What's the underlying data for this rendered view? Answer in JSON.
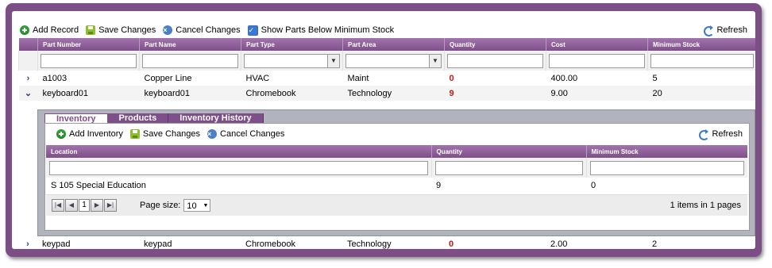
{
  "toolbar": {
    "add_record": "Add Record",
    "save_changes": "Save Changes",
    "cancel_changes": "Cancel Changes",
    "show_parts_below_min": "Show Parts Below Minimum Stock",
    "show_parts_checked": true,
    "refresh": "Refresh"
  },
  "grid": {
    "columns": [
      "Part Number",
      "Part Name",
      "Part Type",
      "Part Area",
      "Quantity",
      "Cost",
      "Minimum Stock"
    ],
    "rows": [
      {
        "part_number": "a1003",
        "part_name": "Copper Line",
        "part_type": "HVAC",
        "part_area": "Maint",
        "quantity": "0",
        "cost": "400.00",
        "minimum_stock": "5"
      },
      {
        "part_number": "keyboard01",
        "part_name": "keyboard01",
        "part_type": "Chromebook",
        "part_area": "Technology",
        "quantity": "9",
        "cost": "9.00",
        "minimum_stock": "20"
      },
      {
        "part_number": "keypad",
        "part_name": "keypad",
        "part_type": "Chromebook",
        "part_area": "Technology",
        "quantity": "0",
        "cost": "2.00",
        "minimum_stock": "2"
      }
    ]
  },
  "detail": {
    "tabs": [
      "Inventory",
      "Products",
      "Inventory History"
    ],
    "active_tab": "Inventory",
    "toolbar": {
      "add_inventory": "Add Inventory",
      "save_changes": "Save Changes",
      "cancel_changes": "Cancel Changes",
      "refresh": "Refresh"
    },
    "columns": [
      "Location",
      "Quantity",
      "Minimum Stock"
    ],
    "rows": [
      {
        "location": "S 105 Special Education",
        "quantity": "9",
        "minimum_stock": "0"
      }
    ],
    "pager": {
      "current_page": "1",
      "page_size_label": "Page size:",
      "page_size": "10",
      "count_total": "1",
      "count_text": "items in",
      "count_pages": "1",
      "pages_text": "pages"
    }
  },
  "colors": {
    "frame": "#7c4e86",
    "header": "#8f619a",
    "alert": "#d01414"
  }
}
